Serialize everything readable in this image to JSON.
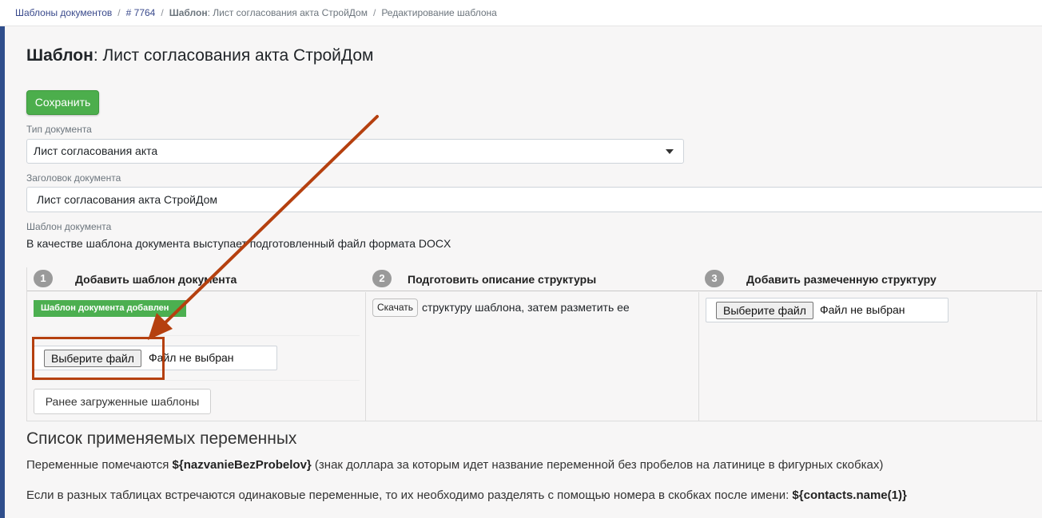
{
  "breadcrumb": {
    "items": [
      "Шаблоны документов",
      "# 7764"
    ],
    "template_label": "Шаблон",
    "template_name": ": Лист согласования акта СтройДом",
    "current": "Редактирование шаблона",
    "separator": "/"
  },
  "header": {
    "title_prefix": "Шаблон",
    "title_name": ": Лист согласования акта СтройДом"
  },
  "toolbar": {
    "save_label": "Сохранить"
  },
  "form": {
    "doc_type_label": "Тип документа",
    "doc_type_value": "Лист согласования акта",
    "doc_title_label": "Заголовок документа",
    "doc_title_value": "Лист согласования акта СтройДом",
    "template_label": "Шаблон документа",
    "template_desc": "В качестве шаблона документа выступает подготовленный файл формата DOCX"
  },
  "steps": [
    {
      "num": "1",
      "title": "Добавить шаблон документа"
    },
    {
      "num": "2",
      "title": "Подготовить описание структуры"
    },
    {
      "num": "3",
      "title": "Добавить размеченную структуру"
    }
  ],
  "step1": {
    "badge": "Шаблон документа добавлен",
    "file_button": "Выберите файл",
    "file_none": "Файл не выбран",
    "prev_button": "Ранее загруженные шаблоны"
  },
  "step2": {
    "download_button": "Скачать",
    "text": "структуру шаблона, затем разметить ее"
  },
  "step3": {
    "file_button": "Выберите файл",
    "file_none": "Файл не выбран"
  },
  "variables": {
    "heading": "Список применяемых переменных",
    "p1_prefix": "Переменные помечаются ",
    "p1_code": "${nazvanieBezProbelov}",
    "p1_suffix": " (знак доллара за которым идет название переменной без пробелов на латинице в фигурных скобках)",
    "p2_prefix": "Если в разных таблицах встречаются одинаковые переменные, то их необходимо разделять с помощью номера в скобках после имени: ",
    "p2_code": "${contacts.name(1)}"
  },
  "colors": {
    "accent_green": "#4cae4c",
    "sidebar_blue": "#2f4e8c",
    "annotation_red": "#b5400f"
  },
  "icons": {
    "dropdown": "chevron-down-icon",
    "annotation": "arrow-icon"
  }
}
